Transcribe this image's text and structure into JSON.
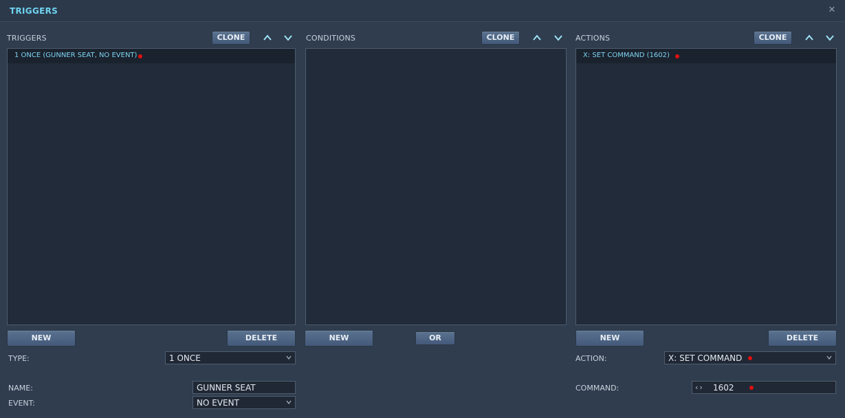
{
  "window": {
    "title": "TRIGGERS",
    "close_glyph": "✕"
  },
  "triggers": {
    "label": "TRIGGERS",
    "clone_label": "CLONE",
    "items": [
      {
        "label": "1 ONCE (GUNNER SEAT, NO EVENT)"
      }
    ],
    "new_label": "NEW",
    "delete_label": "DELETE",
    "type_label": "TYPE:",
    "type_value": "1 ONCE",
    "name_label": "NAME:",
    "name_value": "GUNNER SEAT",
    "event_label": "EVENT:",
    "event_value": "NO EVENT"
  },
  "conditions": {
    "label": "CONDITIONS",
    "clone_label": "CLONE",
    "items": [],
    "new_label": "NEW",
    "or_label": "OR"
  },
  "actions": {
    "label": "ACTIONS",
    "clone_label": "CLONE",
    "items": [
      {
        "label": "X: SET COMMAND (1602)"
      }
    ],
    "new_label": "NEW",
    "delete_label": "DELETE",
    "action_label": "ACTION:",
    "action_value": "X: SET COMMAND",
    "command_label": "COMMAND:",
    "command_value": "1602",
    "stepper_glyphs": "‹›"
  },
  "colors": {
    "title_accent": "#6fd3f0",
    "list_text": "#7fd4f2",
    "error_dot": "#e01010",
    "button": "#4f6786"
  },
  "icons": [
    "close-icon",
    "arrow-up-icon",
    "arrow-down-icon",
    "chevron-down-icon",
    "error-dot-icon"
  ]
}
